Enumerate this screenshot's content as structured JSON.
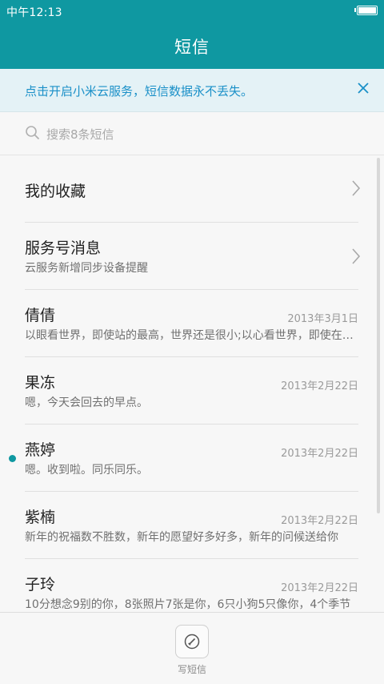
{
  "status_bar": {
    "time": "中午12:13"
  },
  "header": {
    "title": "短信"
  },
  "banner": {
    "text": "点击开启小米云服务，短信数据永不丢失。"
  },
  "search": {
    "placeholder": "搜索8条短信"
  },
  "conversations": [
    {
      "name": "我的收藏",
      "preview": "",
      "date": "",
      "unread": false
    },
    {
      "name": "服务号消息",
      "preview": "云服务新增同步设备提醒",
      "date": "",
      "unread": false
    },
    {
      "name": "倩倩",
      "preview": "以眼看世界，即使站的最高，世界还是很小;以心看世界，即使在最低处，世界也是很大。",
      "date": "2013年3月1日",
      "unread": false
    },
    {
      "name": "果冻",
      "preview": "嗯，今天会回去的早点。",
      "date": "2013年2月22日",
      "unread": false
    },
    {
      "name": "燕婷",
      "preview": "嗯。收到啦。同乐同乐。",
      "date": "2013年2月22日",
      "unread": true
    },
    {
      "name": "紫楠",
      "preview": "新年的祝福数不胜数，新年的愿望好多好多，新年的问候送给你",
      "date": "2013年2月22日",
      "unread": false
    },
    {
      "name": "子玲",
      "preview": "10分想念9别的你，8张照片7张是你，6只小狗5只像你，4个季节",
      "date": "2013年2月22日",
      "unread": false
    }
  ],
  "bottom_bar": {
    "compose_label": "写短信"
  },
  "colors": {
    "accent": "#0f98a1",
    "banner_text": "#1a90c8",
    "banner_bg": "#e4f2f6"
  }
}
